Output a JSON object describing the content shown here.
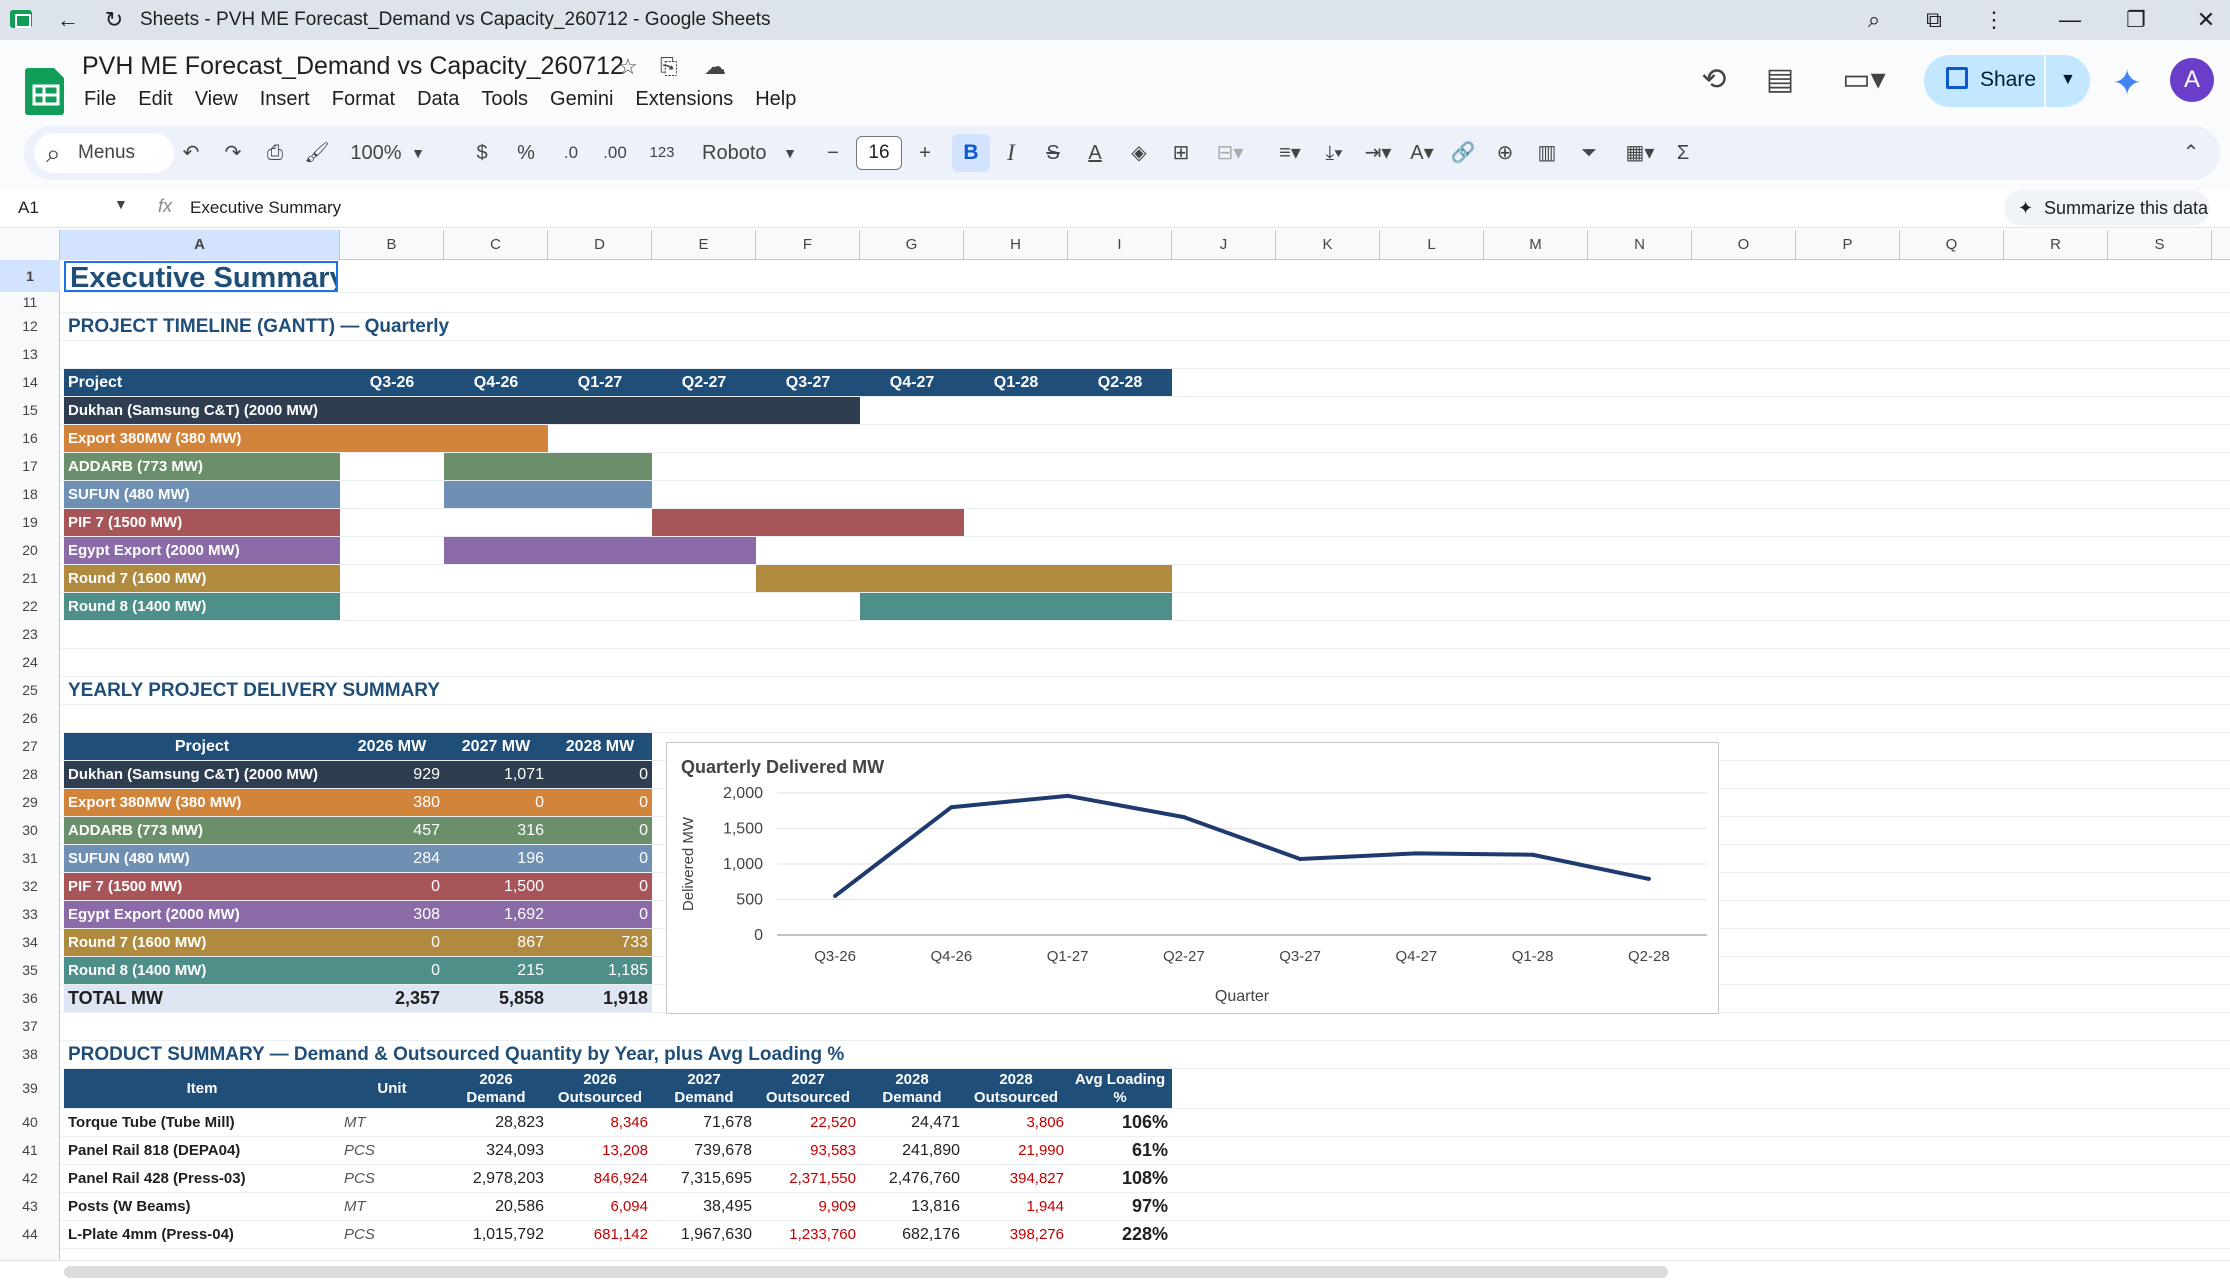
{
  "window": {
    "title": "Sheets - PVH ME Forecast_Demand vs Capacity_260712 - Google Sheets"
  },
  "doc": {
    "title": "PVH ME Forecast_Demand vs Capacity_260712"
  },
  "menu": [
    "File",
    "Edit",
    "View",
    "Insert",
    "Format",
    "Data",
    "Tools",
    "Gemini",
    "Extensions",
    "Help"
  ],
  "share": {
    "label": "Share"
  },
  "avatar": "A",
  "toolbar": {
    "search": "Menus",
    "zoom": "100%",
    "currency": "$",
    "percent": "%",
    "dec_less": ".0",
    "dec_more": ".00",
    "format_123": "123",
    "font": "Roboto",
    "font_size": "16",
    "bold": "B",
    "italic": "I"
  },
  "formula": {
    "cell_ref": "A1",
    "fx": "fx",
    "content": "Executive Summary",
    "summarize": "Summarize this data"
  },
  "columns": [
    "A",
    "B",
    "C",
    "D",
    "E",
    "F",
    "G",
    "H",
    "I",
    "J",
    "K",
    "L",
    "M",
    "N",
    "O",
    "P",
    "Q",
    "R",
    "S"
  ],
  "rows": [
    "1",
    "11",
    "12",
    "13",
    "14",
    "15",
    "16",
    "17",
    "18",
    "19",
    "20",
    "21",
    "22",
    "23",
    "24",
    "25",
    "26",
    "27",
    "28",
    "29",
    "30",
    "31",
    "32",
    "33",
    "34",
    "35",
    "36",
    "37",
    "38",
    "39",
    "40",
    "41",
    "42",
    "43",
    "44"
  ],
  "sheet": {
    "title": "Executive Summary",
    "gantt_title": "PROJECT TIMELINE (GANTT) — Quarterly",
    "gantt_headers": [
      "Project",
      "Q3-26",
      "Q4-26",
      "Q1-27",
      "Q2-27",
      "Q3-27",
      "Q4-27",
      "Q1-28",
      "Q2-28"
    ],
    "gantt": [
      {
        "name": "Dukhan (Samsung C&T) (2000 MW)",
        "color": "#2e3e50",
        "start": 0,
        "end": 5
      },
      {
        "name": "Export 380MW (380 MW)",
        "color": "#d1843a",
        "start": 0,
        "end": 2
      },
      {
        "name": "ADDARB (773 MW)",
        "color": "#6a8f6a",
        "start": 1,
        "end": 3
      },
      {
        "name": "SUFUN (480 MW)",
        "color": "#6f8fb3",
        "start": 1,
        "end": 3
      },
      {
        "name": "PIF 7 (1500 MW)",
        "color": "#a8555a",
        "start": 3,
        "end": 6
      },
      {
        "name": "Egypt Export (2000 MW)",
        "color": "#8a6ba8",
        "start": 1,
        "end": 4
      },
      {
        "name": "Round 7 (1600 MW)",
        "color": "#b08a3e",
        "start": 4,
        "end": 8
      },
      {
        "name": "Round 8 (1400 MW)",
        "color": "#4e8f8a",
        "start": 5,
        "end": 8
      }
    ],
    "yearly_title": "YEARLY PROJECT DELIVERY SUMMARY",
    "yearly_headers": [
      "Project",
      "2026 MW",
      "2027 MW",
      "2028 MW"
    ],
    "yearly": [
      {
        "name": "Dukhan (Samsung C&T) (2000 MW)",
        "v": [
          "929",
          "1,071",
          "0"
        ],
        "color": "#2e3e50"
      },
      {
        "name": "Export 380MW (380 MW)",
        "v": [
          "380",
          "0",
          "0"
        ],
        "color": "#d1843a"
      },
      {
        "name": "ADDARB (773 MW)",
        "v": [
          "457",
          "316",
          "0"
        ],
        "color": "#6a8f6a"
      },
      {
        "name": "SUFUN (480 MW)",
        "v": [
          "284",
          "196",
          "0"
        ],
        "color": "#6f8fb3"
      },
      {
        "name": "PIF 7 (1500 MW)",
        "v": [
          "0",
          "1,500",
          "0"
        ],
        "color": "#a8555a"
      },
      {
        "name": "Egypt Export (2000 MW)",
        "v": [
          "308",
          "1,692",
          "0"
        ],
        "color": "#8a6ba8"
      },
      {
        "name": "Round 7 (1600 MW)",
        "v": [
          "0",
          "867",
          "733"
        ],
        "color": "#b08a3e"
      },
      {
        "name": "Round 8 (1400 MW)",
        "v": [
          "0",
          "215",
          "1,185"
        ],
        "color": "#4e8f8a"
      }
    ],
    "yearly_total": {
      "label": "TOTAL MW",
      "v": [
        "2,357",
        "5,858",
        "1,918"
      ]
    },
    "product_title": "PRODUCT SUMMARY — Demand & Outsourced Quantity by Year, plus Avg Loading %",
    "product_headers": [
      "Item",
      "Unit",
      "2026 Demand",
      "2026 Outsourced",
      "2027 Demand",
      "2027 Outsourced",
      "2028 Demand",
      "2028 Outsourced",
      "Avg Loading %"
    ],
    "products": [
      {
        "item": "Torque Tube (Tube Mill)",
        "unit": "MT",
        "v": [
          "28,823",
          "8,346",
          "71,678",
          "22,520",
          "24,471",
          "3,806"
        ],
        "load": "106%"
      },
      {
        "item": "Panel Rail 818 (DEPA04)",
        "unit": "PCS",
        "v": [
          "324,093",
          "13,208",
          "739,678",
          "93,583",
          "241,890",
          "21,990"
        ],
        "load": "61%"
      },
      {
        "item": "Panel Rail 428 (Press-03)",
        "unit": "PCS",
        "v": [
          "2,978,203",
          "846,924",
          "7,315,695",
          "2,371,550",
          "2,476,760",
          "394,827"
        ],
        "load": "108%"
      },
      {
        "item": "Posts (W Beams)",
        "unit": "MT",
        "v": [
          "20,586",
          "6,094",
          "38,495",
          "9,909",
          "13,816",
          "1,944"
        ],
        "load": "97%"
      },
      {
        "item": "L-Plate 4mm (Press-04)",
        "unit": "PCS",
        "v": [
          "1,015,792",
          "681,142",
          "1,967,630",
          "1,233,760",
          "682,176",
          "398,276"
        ],
        "load": "228%"
      }
    ]
  },
  "chart_data": {
    "type": "line",
    "title": "Quarterly Delivered MW",
    "xlabel": "Quarter",
    "ylabel": "Delivered MW",
    "categories": [
      "Q3-26",
      "Q4-26",
      "Q1-27",
      "Q2-27",
      "Q3-27",
      "Q4-27",
      "Q1-28",
      "Q2-28"
    ],
    "values": [
      550,
      1800,
      1960,
      1660,
      1070,
      1150,
      1130,
      790
    ],
    "ylim": [
      0,
      2000
    ],
    "yticks": [
      "0",
      "500",
      "1,000",
      "1,500",
      "2,000"
    ],
    "line_color": "#1f3a6e"
  }
}
